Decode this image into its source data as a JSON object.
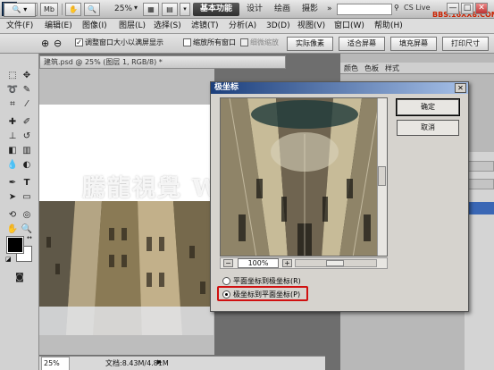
{
  "titlebar": {
    "logo": "Ps",
    "br_btn": "Br",
    "mb_btn": "Mb",
    "zoom": "25%",
    "workspaces": [
      "基本功能",
      "设计",
      "绘画",
      "摄影"
    ],
    "more": "»",
    "cs_live": "CS Live",
    "watermark_top": "BBS.16XX8.COM",
    "minimize": "—",
    "restore": "□",
    "close": "✕"
  },
  "menubar": {
    "items": [
      "文件(F)",
      "编辑(E)",
      "图像(I)",
      "图层(L)",
      "选择(S)",
      "滤镜(T)",
      "分析(A)",
      "3D(D)",
      "视图(V)",
      "窗口(W)",
      "帮助(H)"
    ]
  },
  "optionsbar": {
    "resize_windows": "调整窗口大小以满屏显示",
    "zoom_all": "缩放所有窗口",
    "scrubby_zoom": "细微缩放",
    "actual_pixels": "实际像素",
    "fit_screen": "适合屏幕",
    "fill_screen": "填充屏幕",
    "print_size": "打印尺寸"
  },
  "document": {
    "tab_title": "建筑.psd @ 25% (图层 1, RGB/8) *",
    "status_zoom": "25%",
    "status_doc": "文档:8.43M/4.81M"
  },
  "watermark": "騰龍視覺 WWW.TLSJ.NET",
  "panels": {
    "tabs": [
      "颜色",
      "色板",
      "样式"
    ]
  },
  "dialog": {
    "title": "极坐标",
    "ok": "确定",
    "cancel": "取消",
    "zoom_minus": "−",
    "zoom_plus": "+",
    "zoom_value": "100%",
    "option_rect_to_polar": "平面坐标到极坐标(R)",
    "option_polar_to_rect": "极坐标到平面坐标(P)",
    "selected_option": "polar_to_rect"
  },
  "colors": {
    "highlight": "#d01010",
    "dialog_title_start": "#1c3f7c",
    "foreground": "#000000",
    "background": "#ffffff"
  }
}
